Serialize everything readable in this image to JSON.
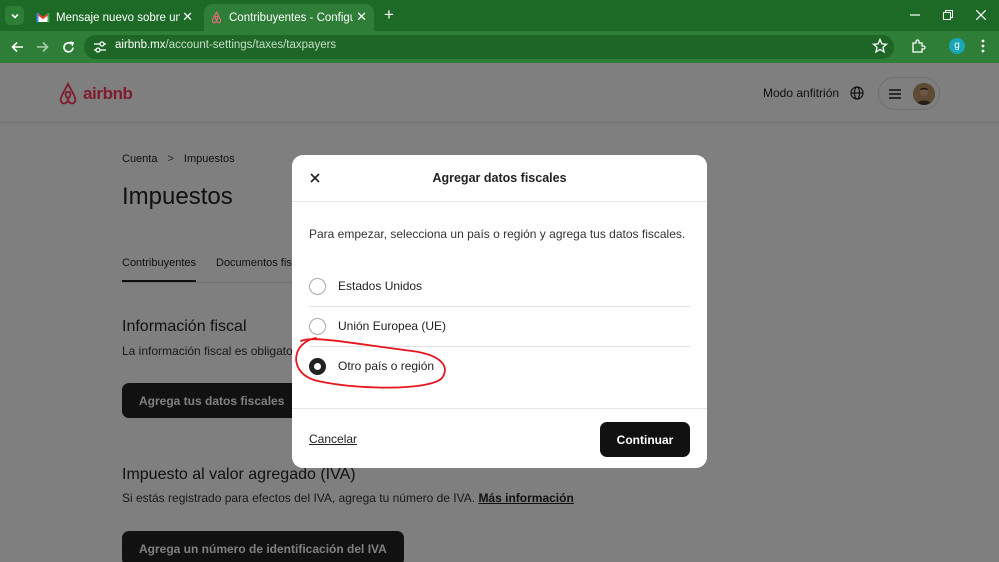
{
  "browser": {
    "tabs": [
      {
        "title": "Mensaje nuevo sobre un servicio",
        "active": false,
        "favicon": "gmail-icon"
      },
      {
        "title": "Contribuyentes - Configuración",
        "active": true,
        "favicon": "airbnb-icon"
      }
    ],
    "url_host": "airbnb.mx",
    "url_path": "/account-settings/taxes/taxpayers",
    "profile_initial": "g"
  },
  "site": {
    "brand": "airbnb",
    "host_mode": "Modo anfitrión",
    "brand_color": "#ff385c"
  },
  "page": {
    "breadcrumb": [
      "Cuenta",
      "Impuestos"
    ],
    "breadcrumb_sep": ">",
    "title": "Impuestos",
    "tabs": [
      "Contribuyentes",
      "Documentos fiscales"
    ],
    "fiscal": {
      "title": "Información fiscal",
      "text": "La información fiscal es obligatoria",
      "button": "Agrega tus datos fiscales"
    },
    "vat": {
      "title": "Impuesto al valor agregado (IVA)",
      "text": "Si estás registrado para efectos del IVA, agrega tu número de IVA.",
      "link": "Más información",
      "button": "Agrega un número de identificación del IVA"
    }
  },
  "modal": {
    "title": "Agregar datos fiscales",
    "intro": "Para empezar, selecciona un país o región y agrega tus datos fiscales.",
    "options": [
      {
        "label": "Estados Unidos",
        "checked": false
      },
      {
        "label": "Unión Europea (UE)",
        "checked": false
      },
      {
        "label": "Otro país o región",
        "checked": true
      }
    ],
    "cancel": "Cancelar",
    "continue": "Continuar"
  }
}
